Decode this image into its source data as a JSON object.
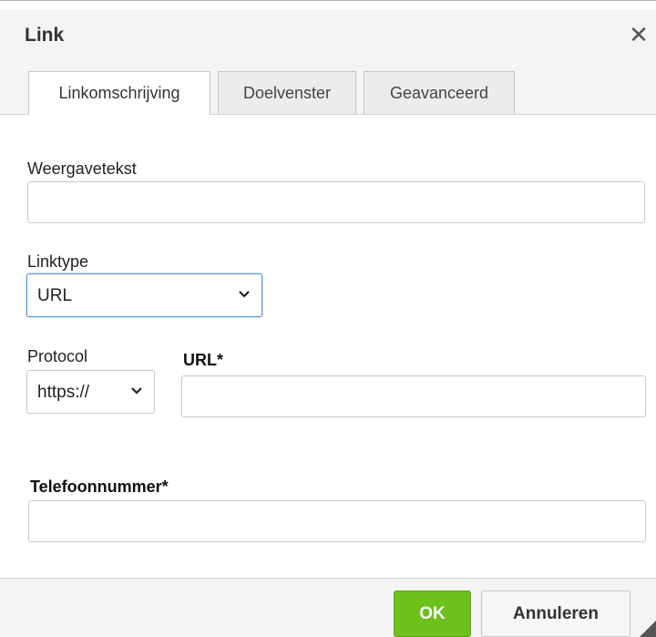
{
  "dialog": {
    "title": "Link",
    "close_icon": "close-icon"
  },
  "tabs": [
    {
      "label": "Linkomschrijving",
      "active": true
    },
    {
      "label": "Doelvenster",
      "active": false
    },
    {
      "label": "Geavanceerd",
      "active": false
    }
  ],
  "form": {
    "display_text": {
      "label": "Weergavetekst",
      "value": ""
    },
    "link_type": {
      "label": "Linktype",
      "selected": "URL"
    },
    "protocol": {
      "label": "Protocol",
      "selected": "https://"
    },
    "url": {
      "label": "URL*",
      "value": ""
    },
    "phone": {
      "label": "Telefoonnummer*",
      "value": ""
    }
  },
  "footer": {
    "ok_label": "OK",
    "cancel_label": "Annuleren"
  },
  "colors": {
    "ok_button": "#6ec01d",
    "focus_border": "#4d90d6"
  }
}
